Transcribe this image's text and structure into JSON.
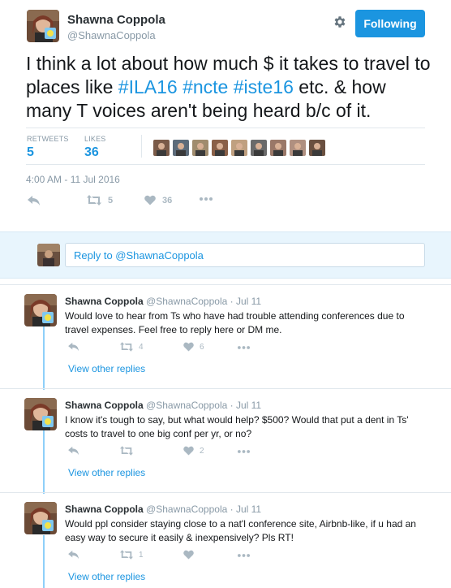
{
  "tweet": {
    "author_name": "Shawna Coppola",
    "author_handle": "@ShawnaCoppola",
    "follow_label": "Following",
    "text_before": "I think a lot about how much $ it takes to travel to places like ",
    "hashtag_1": "#ILA16",
    "hashtag_2": "#ncte",
    "hashtag_3": "#iste16",
    "text_after": " etc. & how many T voices aren't being heard b/c of it.",
    "retweets_label": "RETWEETS",
    "retweets_count": "5",
    "likes_label": "LIKES",
    "likes_count": "36",
    "timestamp": "4:00 AM - 11 Jul 2016",
    "action_retweets": "5",
    "action_likes": "36"
  },
  "likers": [
    {
      "name": "liker-1",
      "color": "#7a5a48"
    },
    {
      "name": "liker-2",
      "color": "#5c6b7a"
    },
    {
      "name": "liker-3",
      "color": "#a08c6e"
    },
    {
      "name": "liker-4",
      "color": "#8a6048"
    },
    {
      "name": "liker-5",
      "color": "#c0a080"
    },
    {
      "name": "liker-6",
      "color": "#6a6a6a"
    },
    {
      "name": "liker-7",
      "color": "#9a7868"
    },
    {
      "name": "liker-8",
      "color": "#b09080"
    },
    {
      "name": "liker-9",
      "color": "#6a5040"
    }
  ],
  "reply_box": {
    "placeholder": "Reply to @ShawnaCoppola"
  },
  "replies": [
    {
      "name": "Shawna Coppola",
      "handle_date": "@ShawnaCoppola · Jul 11",
      "text": "Would love to hear from Ts who have had trouble attending conferences due to travel expenses. Feel free to reply here or DM me.",
      "retweets": "4",
      "likes": "6",
      "view_other": "View other replies"
    },
    {
      "name": "Shawna Coppola",
      "handle_date": "@ShawnaCoppola · Jul 11",
      "text": "I know it's tough to say, but what would help? $500? Would that put a dent in Ts' costs to travel to one big conf per yr, or no?",
      "retweets": "",
      "likes": "2",
      "view_other": "View other replies"
    },
    {
      "name": "Shawna Coppola",
      "handle_date": "@ShawnaCoppola · Jul 11",
      "text": "Would ppl consider staying close to a nat'l conference site, Airbnb-like, if u had an easy way to secure it easily & inexpensively? Pls RT!",
      "retweets": "1",
      "likes": "",
      "view_other": "View other replies"
    }
  ],
  "colors": {
    "accent": "#1b95e0",
    "muted": "#8899a6",
    "icon": "#aab8c2",
    "thread": "#8ed0f9",
    "reply_bg": "#e8f5fd"
  }
}
